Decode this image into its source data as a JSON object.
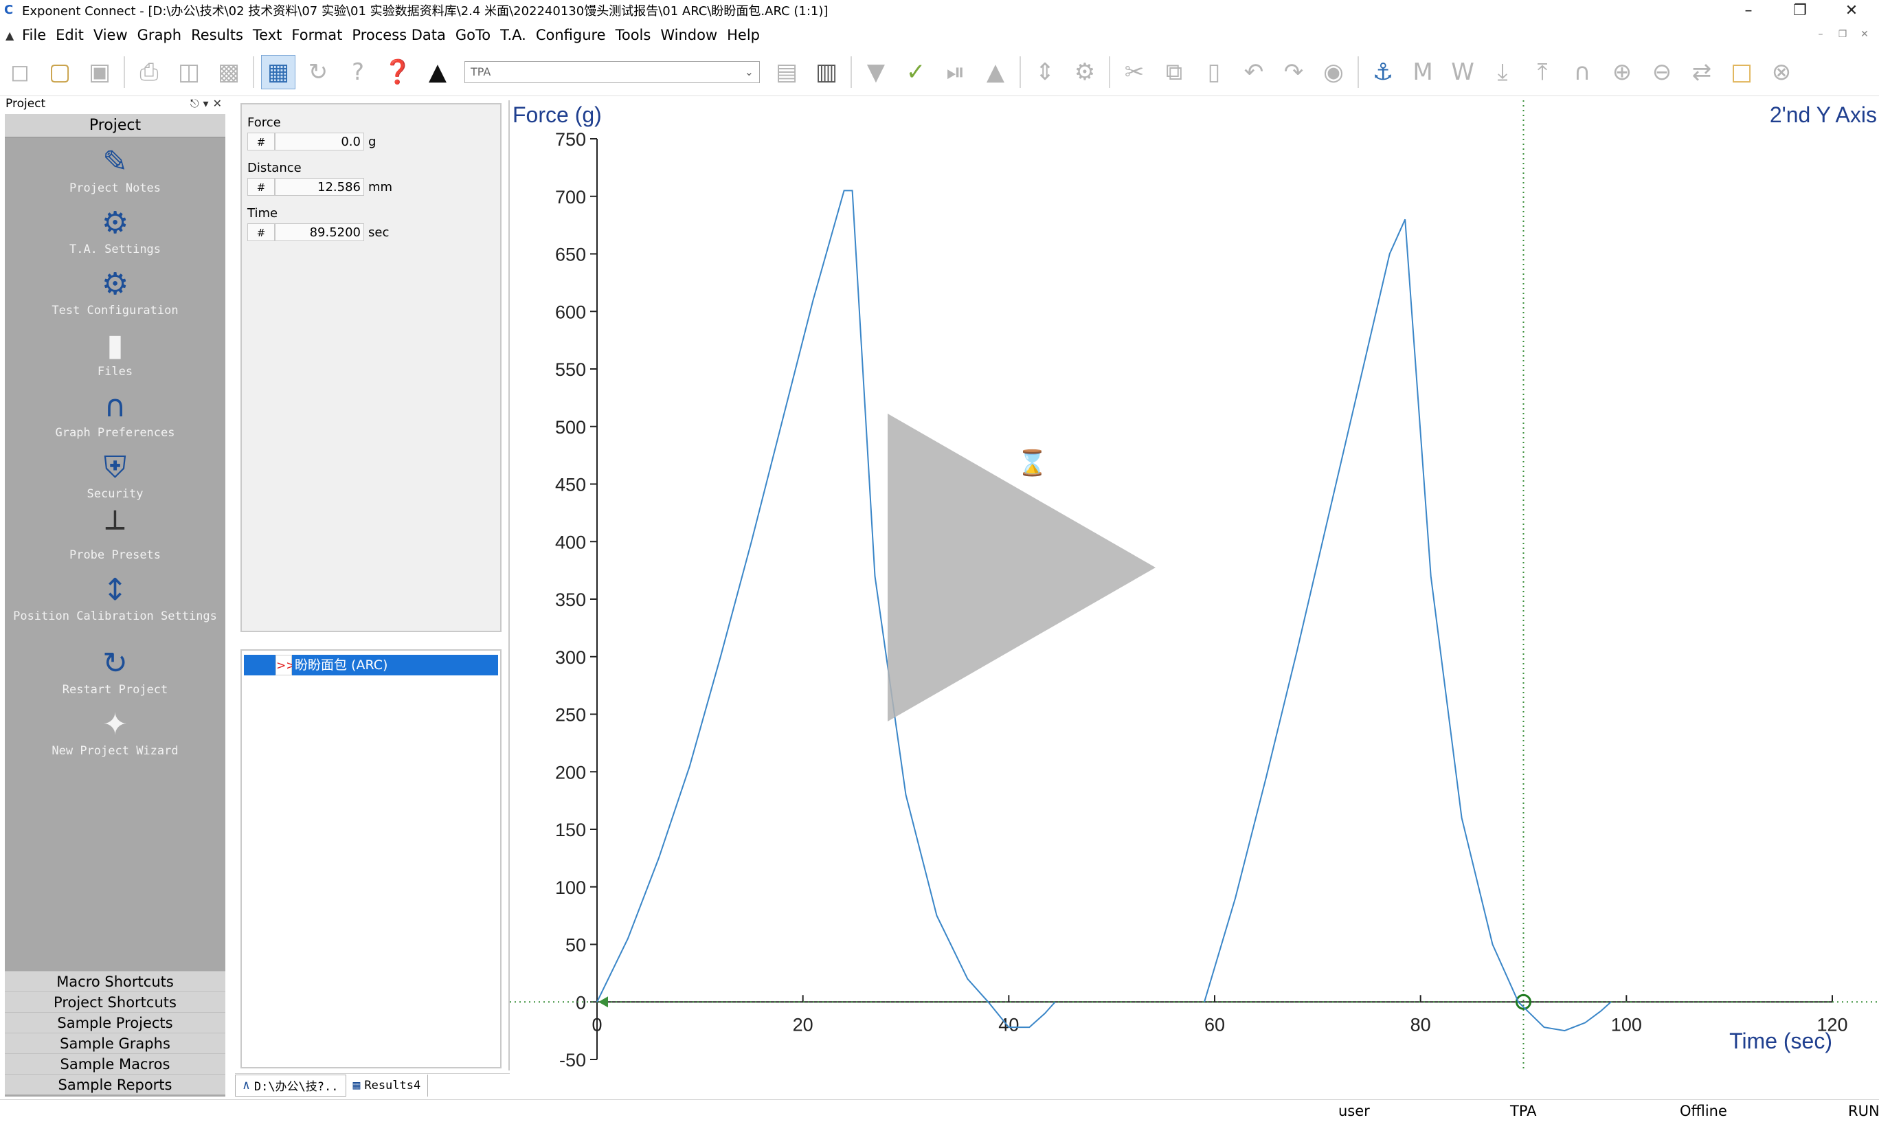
{
  "window": {
    "title": "Exponent Connect - [D:\\办公\\技术\\02 技术资料\\07 实验\\01 实验数据资料库\\2.4 米面\\202240130馒头测试报告\\01 ARC\\盼盼面包.ARC (1:1)]"
  },
  "menu": {
    "items": [
      "File",
      "Edit",
      "View",
      "Graph",
      "Results",
      "Text",
      "Format",
      "Process Data",
      "GoTo",
      "T.A.",
      "Configure",
      "Tools",
      "Window",
      "Help"
    ]
  },
  "toolbar": {
    "combo_value": "TPA"
  },
  "project": {
    "header": "Project",
    "title": "Project",
    "items": [
      {
        "label": "Project Notes",
        "icon": "pencil-note-icon"
      },
      {
        "label": "T.A. Settings",
        "icon": "ta-settings-icon"
      },
      {
        "label": "Test Configuration",
        "icon": "gear-icon"
      },
      {
        "label": "Files",
        "icon": "file-icon"
      },
      {
        "label": "Graph Preferences",
        "icon": "graph-gear-icon"
      },
      {
        "label": "Security",
        "icon": "shield-lock-icon"
      },
      {
        "label": "Probe Presets",
        "icon": "probe-icon"
      },
      {
        "label": "Position Calibration Settings",
        "icon": "vertical-arrows-icon"
      },
      {
        "label": "Restart Project",
        "icon": "refresh-icon"
      },
      {
        "label": "New Project Wizard",
        "icon": "wand-icon"
      }
    ],
    "shortcuts": [
      "Macro Shortcuts",
      "Project Shortcuts",
      "Sample Projects",
      "Sample Graphs",
      "Sample Macros",
      "Sample Reports"
    ]
  },
  "readouts": [
    {
      "label": "Force",
      "hash": "#",
      "value": "0.0",
      "unit": "g"
    },
    {
      "label": "Distance",
      "hash": "#",
      "value": "12.586",
      "unit": "mm"
    },
    {
      "label": "Time",
      "hash": "#",
      "value": "89.5200",
      "unit": "sec"
    }
  ],
  "files": {
    "marker": ">>",
    "selected": "盼盼面包 (ARC)"
  },
  "bottom_tabs": [
    "D:\\办公\\技?..",
    "Results4"
  ],
  "status": {
    "user": "user",
    "test": "TPA",
    "connection": "Offline",
    "mode": "RUN"
  },
  "chart_data": {
    "type": "line",
    "ylabel": "Force (g)",
    "y2label": "2'nd Y Axis",
    "xlabel": "Time (sec)",
    "xlim": [
      0,
      120
    ],
    "ylim": [
      -50,
      750
    ],
    "xticks": [
      0,
      20,
      40,
      60,
      80,
      100,
      120
    ],
    "yticks": [
      -50,
      0,
      50,
      100,
      150,
      200,
      250,
      300,
      350,
      400,
      450,
      500,
      550,
      600,
      650,
      700,
      750
    ],
    "grid": false,
    "cursor_x": 90,
    "line_color": "#3a86c8",
    "axis_label_color": "#1f3f8f",
    "series": [
      {
        "x": [
          0,
          3,
          6,
          9,
          12,
          15,
          18,
          21,
          24,
          24.8,
          27,
          30,
          33,
          36,
          38,
          40,
          42,
          43.5,
          44.5
        ],
        "y": [
          0,
          55,
          125,
          205,
          300,
          400,
          505,
          610,
          705,
          705,
          370,
          180,
          75,
          20,
          0,
          -22,
          -22,
          -10,
          0
        ]
      },
      {
        "x": [
          59,
          62,
          65,
          68,
          71,
          74,
          77,
          78.5,
          81,
          84,
          87,
          89.5,
          92,
          94,
          96,
          97.5,
          98.5
        ],
        "y": [
          0,
          90,
          195,
          305,
          420,
          535,
          650,
          680,
          370,
          160,
          50,
          0,
          -22,
          -25,
          -18,
          -8,
          0
        ]
      }
    ]
  }
}
